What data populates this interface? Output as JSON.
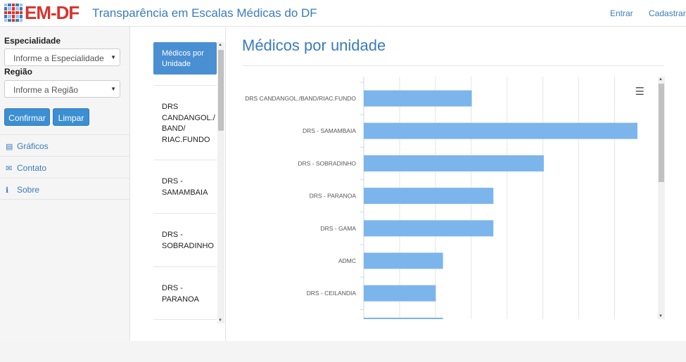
{
  "header": {
    "logo_text": "EM-DF",
    "app_title": "Transparência em Escalas Médicas do DF",
    "login_label": "Entrar",
    "signup_label": "Cadastrar"
  },
  "sidebar": {
    "especialidade_label": "Especialidade",
    "especialidade_value": "Informe a Especialidade",
    "regiao_label": "Região",
    "regiao_value": "Informe a Região",
    "confirm_label": "Confirmar",
    "clear_label": "Limpar",
    "menu": [
      {
        "label": "Gráficos",
        "icon": "chart-icon"
      },
      {
        "label": "Contato",
        "icon": "envelope-icon"
      },
      {
        "label": "Sobre",
        "icon": "info-icon"
      }
    ]
  },
  "chart_list": {
    "active": "Médicos por Unidade",
    "items": [
      "DRS CANDANGOL./ BAND/ RIAC.FUNDO",
      "DRS - SAMAMBAIA",
      "DRS - SOBRADINHO",
      "DRS - PARANOA"
    ]
  },
  "main": {
    "title": "Médicos por unidade"
  },
  "chart_data": {
    "type": "bar",
    "orientation": "horizontal",
    "title": "",
    "xlabel": "",
    "ylabel": "",
    "categories": [
      "DRS CANDANGOL./BAND/RIAC.FUNDO",
      "DRS - SAMAMBAIA",
      "DRS - SOBRADINHO",
      "DRS - PARANOA",
      "DRS - GAMA",
      "ADMC",
      "DRS - CEILANDIA",
      ""
    ],
    "values": [
      30,
      76,
      50,
      36,
      36,
      22,
      20,
      22
    ],
    "xlim": [
      0,
      76
    ],
    "bar_color": "#7cb5ec",
    "grid": true
  }
}
